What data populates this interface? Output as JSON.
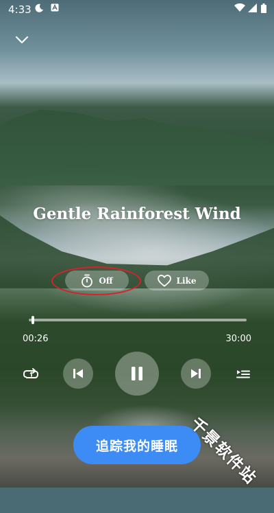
{
  "status_bar": {
    "time": "4:33",
    "icons": [
      "moon-icon",
      "app-notification-icon",
      "wifi-icon",
      "signal-icon",
      "battery-icon"
    ]
  },
  "player": {
    "title": "Gentle Rainforest Wind",
    "timer_label": "Off",
    "like_label": "Like",
    "elapsed": "00:26",
    "total": "30:00",
    "progress_fraction": 0.014,
    "state": "playing"
  },
  "controls": {
    "repeat_icon": "repeat-one-icon",
    "previous_icon": "skip-previous-icon",
    "pause_icon": "pause-icon",
    "next_icon": "skip-next-icon",
    "playlist_icon": "playlist-icon"
  },
  "cta": {
    "label": "追踪我的睡眠",
    "color": "#3d8bf5"
  },
  "watermark": {
    "text": "千景软件站"
  },
  "colors": {
    "highlight_ring": "#d8222a",
    "pill_background": "rgba(255,255,255,0.28)"
  }
}
